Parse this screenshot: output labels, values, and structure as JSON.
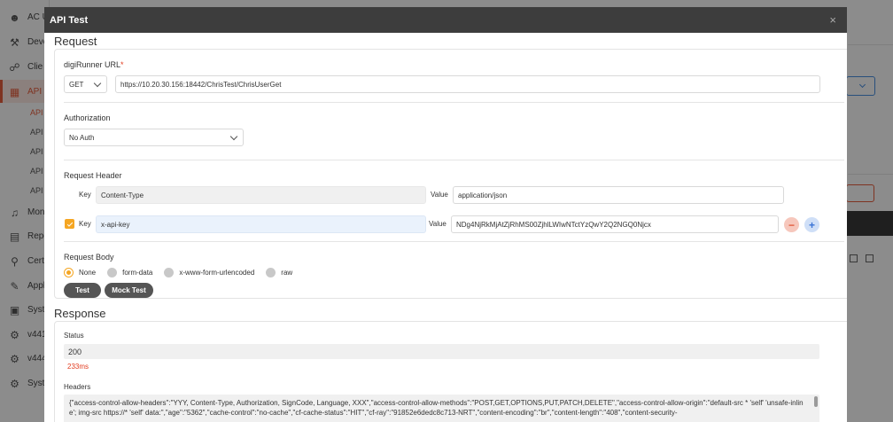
{
  "background": {
    "nav": [
      {
        "label": "AC U",
        "icon": "user-group-icon"
      },
      {
        "label": "Deve",
        "icon": "wrench-icon"
      },
      {
        "label": "Clie",
        "icon": "nodes-icon"
      },
      {
        "label": "API",
        "icon": "api-icon"
      },
      {
        "label": "Moni",
        "icon": "bell-icon"
      },
      {
        "label": "Repo",
        "icon": "chart-icon"
      },
      {
        "label": "Certi",
        "icon": "search-icon"
      },
      {
        "label": "Appl",
        "icon": "edit-icon"
      },
      {
        "label": "Syst",
        "icon": "lock-icon"
      },
      {
        "label": "v441",
        "icon": "gear-icon"
      },
      {
        "label": "v444",
        "icon": "gear-icon"
      },
      {
        "label": "Syst",
        "icon": "settings-icon"
      }
    ],
    "sub_items": [
      "API",
      "API I",
      "API I",
      "API",
      "API I"
    ],
    "accent": "#e85d3c"
  },
  "modal": {
    "title": "API Test",
    "close": "×",
    "request": {
      "section_title": "Request",
      "url_label": "digiRunner URL",
      "required_mark": "*",
      "method": "GET",
      "url": "https://10.20.30.156:18442/ChrisTest/ChrisUserGet",
      "auth_label": "Authorization",
      "auth_value": "No Auth",
      "header_label": "Request Header",
      "headers": [
        {
          "key_label": "Key",
          "key": "Content-Type",
          "value_label": "Value",
          "value": "application/json"
        },
        {
          "key_label": "Key",
          "key": "x-api-key",
          "value_label": "Value",
          "value": "NDg4NjRkMjAtZjRhMS00ZjhlLWIwNTctYzQwY2Q2NGQ0Njcx"
        }
      ],
      "body_label": "Request Body",
      "body_options": [
        "None",
        "form-data",
        "x-www-form-urlencoded",
        "raw"
      ],
      "test_button": "Test",
      "mock_button": "Mock Test"
    },
    "response": {
      "section_title": "Response",
      "status_label": "Status",
      "status_value": "200",
      "time": "233ms",
      "headers_label": "Headers",
      "headers_text": "{\"access-control-allow-headers\":\"YYY, Content-Type, Authorization, SignCode, Language, XXX\",\"access-control-allow-methods\":\"POST,GET,OPTIONS,PUT,PATCH,DELETE\",\"access-control-allow-origin\":\"default-src * 'self' 'unsafe-inline'; img-src https://* 'self' data:\",\"age\":\"5362\",\"cache-control\":\"no-cache\",\"cf-cache-status\":\"HIT\",\"cf-ray\":\"91852e6dedc8c713-NRT\",\"content-encoding\":\"br\",\"content-length\":\"408\",\"content-security-"
    }
  }
}
